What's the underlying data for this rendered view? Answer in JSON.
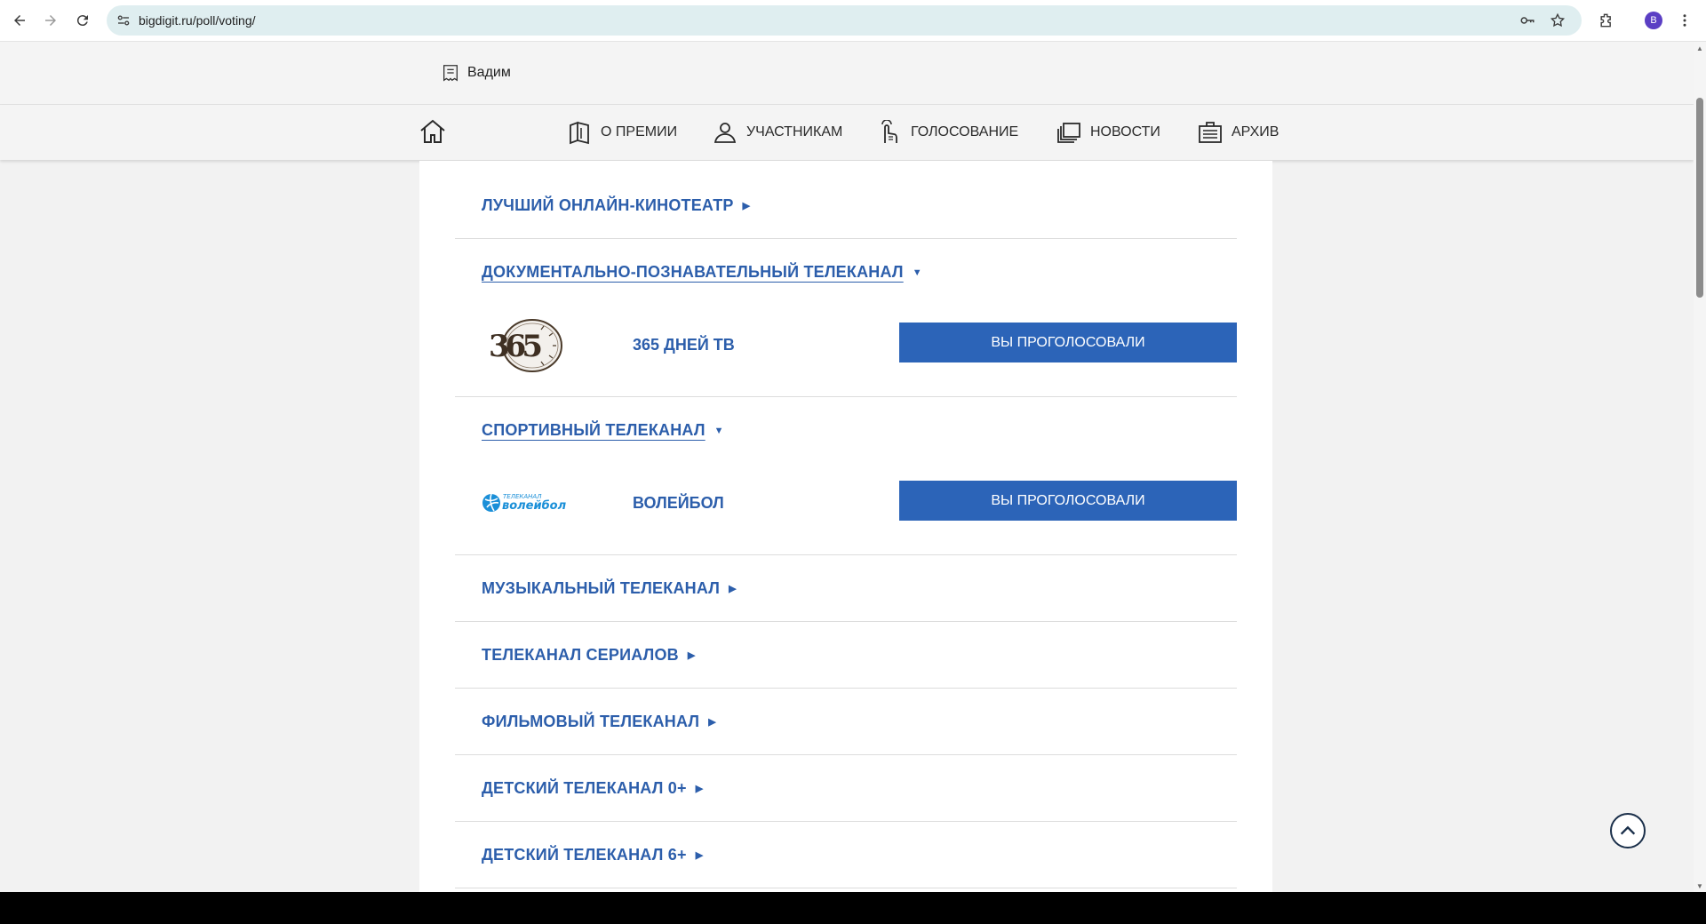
{
  "browser": {
    "url": "bigdigit.ru/poll/voting/",
    "avatar_letter": "B"
  },
  "user": {
    "name": "Вадим"
  },
  "nav": {
    "items": [
      {
        "label": "О ПРЕМИИ",
        "icon": "book-icon"
      },
      {
        "label": "УЧАСТНИКАМ",
        "icon": "person-icon"
      },
      {
        "label": "ГОЛОСОВАНИЕ",
        "icon": "vote-hand-icon"
      },
      {
        "label": "НОВОСТИ",
        "icon": "news-stack-icon"
      },
      {
        "label": "АРХИВ",
        "icon": "archive-icon"
      }
    ]
  },
  "categories": [
    {
      "title": "ЛУЧШИЙ ОНЛАЙН-КИНОТЕАТР",
      "expanded": false
    },
    {
      "title": "ДОКУМЕНТАЛЬНО-ПОЗНАВАТЕЛЬНЫЙ ТЕЛЕКАНАЛ",
      "expanded": true,
      "entry": {
        "name": "365 ДНЕЙ ТВ",
        "button": "ВЫ ПРОГОЛОСОВАЛИ",
        "logo_text": "365"
      }
    },
    {
      "title": "СПОРТИВНЫЙ ТЕЛЕКАНАЛ",
      "expanded": true,
      "entry": {
        "name": "ВОЛЕЙБОЛ",
        "button": "ВЫ ПРОГОЛОСОВАЛИ",
        "logo_top": "ТЕЛЕКАНАЛ",
        "logo_main": "волейбол"
      }
    },
    {
      "title": "МУЗЫКАЛЬНЫЙ ТЕЛЕКАНАЛ",
      "expanded": false
    },
    {
      "title": "ТЕЛЕКАНАЛ СЕРИАЛОВ",
      "expanded": false
    },
    {
      "title": "ФИЛЬМОВЫЙ ТЕЛЕКАНАЛ",
      "expanded": false
    },
    {
      "title": "ДЕТСКИЙ ТЕЛЕКАНАЛ 0+",
      "expanded": false
    },
    {
      "title": "ДЕТСКИЙ ТЕЛЕКАНАЛ 6+",
      "expanded": false
    }
  ],
  "arrows": {
    "collapsed": "▶",
    "expanded": "▼"
  },
  "colors": {
    "link": "#2c5eab",
    "button": "#2c64b8"
  }
}
